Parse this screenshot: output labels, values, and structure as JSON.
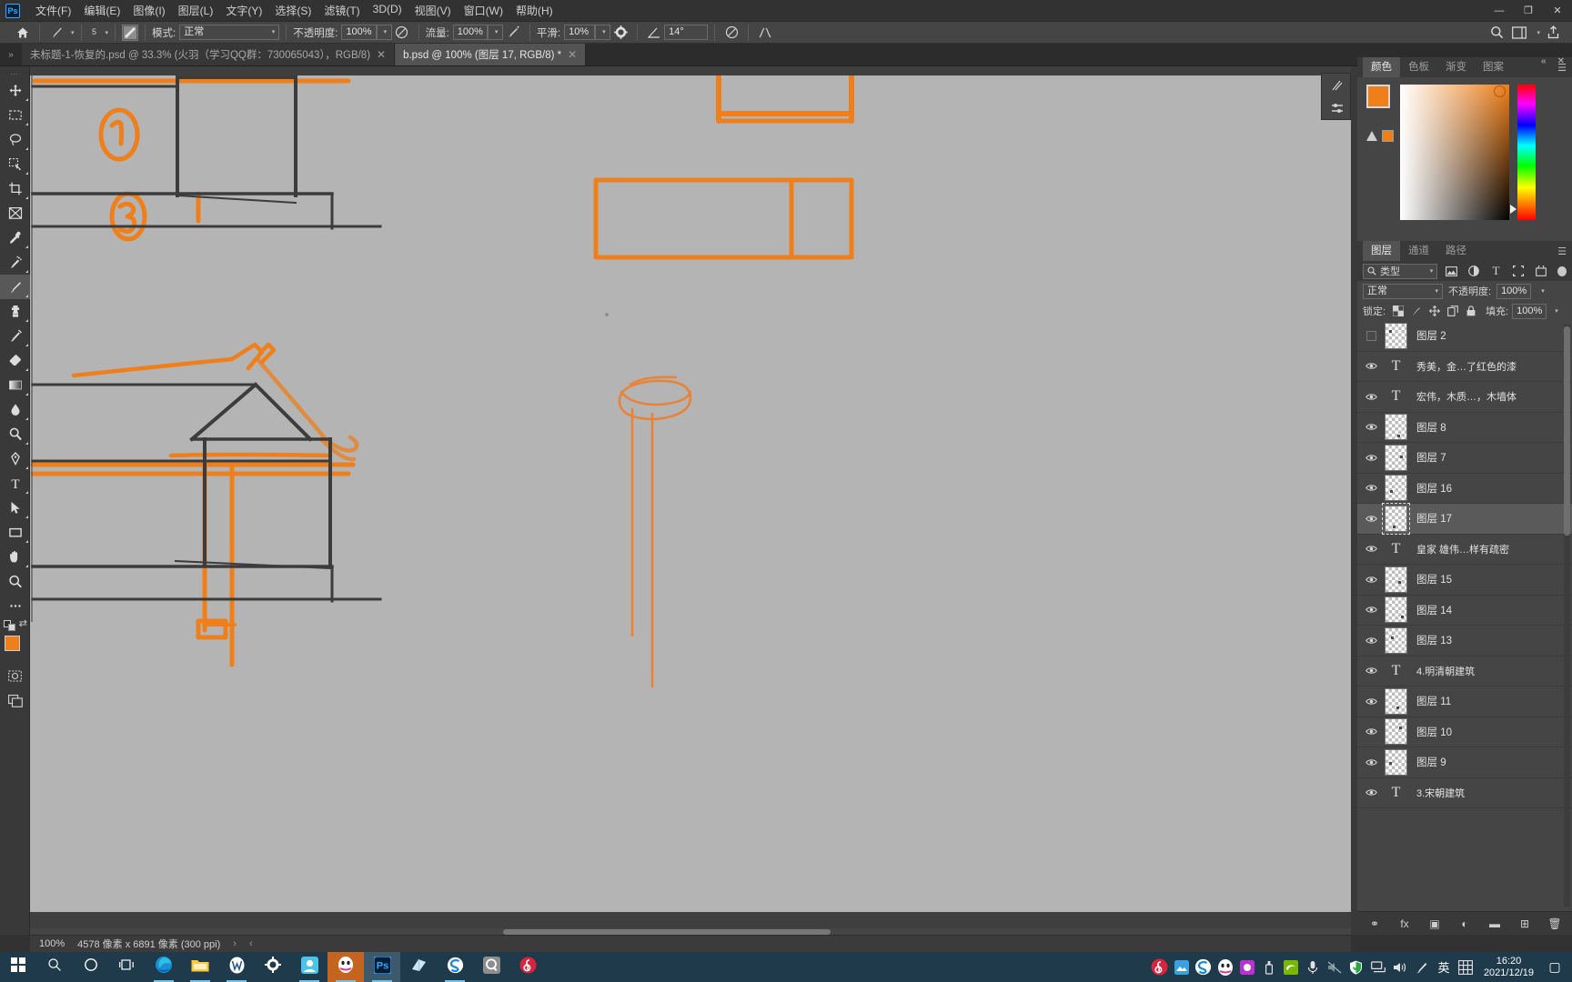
{
  "app": {
    "name": "Photoshop",
    "logo_text": "Ps"
  },
  "menubar": {
    "items": [
      {
        "label": "文件(F)",
        "name": "menu-file"
      },
      {
        "label": "编辑(E)",
        "name": "menu-edit"
      },
      {
        "label": "图像(I)",
        "name": "menu-image"
      },
      {
        "label": "图层(L)",
        "name": "menu-layer"
      },
      {
        "label": "文字(Y)",
        "name": "menu-type"
      },
      {
        "label": "选择(S)",
        "name": "menu-select"
      },
      {
        "label": "滤镜(T)",
        "name": "menu-filter"
      },
      {
        "label": "3D(D)",
        "name": "menu-3d"
      },
      {
        "label": "视图(V)",
        "name": "menu-view"
      },
      {
        "label": "窗口(W)",
        "name": "menu-window"
      },
      {
        "label": "帮助(H)",
        "name": "menu-help"
      }
    ],
    "window_controls": {
      "minimize": "—",
      "maximize": "❐",
      "close": "✕"
    }
  },
  "options_bar": {
    "home_icon": "home-icon",
    "brush_preset_icon": "brush-icon",
    "brush_size_label": "5",
    "toggle_panel_icon": "brush-panel-icon",
    "mode_label": "模式:",
    "mode_value": "正常",
    "opacity_label": "不透明度:",
    "opacity_value": "100%",
    "pressure_opacity_icon": "pressure-opacity-icon",
    "flow_label": "流量:",
    "flow_value": "100%",
    "airbrush_icon": "airbrush-icon",
    "smoothing_label": "平滑:",
    "smoothing_value": "10%",
    "gear_icon": "gear-icon",
    "angle_icon": "angle-icon",
    "angle_value": "14°",
    "pressure_size_icon": "pressure-size-icon",
    "symmetry_icon": "symmetry-icon",
    "search_icon": "search-icon",
    "workspace_icon": "workspace-icon",
    "share_icon": "share-icon"
  },
  "tabs": {
    "overflow_icon": "chevron-double-right-icon",
    "items": [
      {
        "label": "未标题-1-恢复的.psd @ 33.3% (火羽（学习QQ群：730065043），RGB/8)",
        "active": false,
        "close": "✕"
      },
      {
        "label": "b.psd @ 100% (图层 17, RGB/8) *",
        "active": true,
        "close": "✕"
      }
    ]
  },
  "toolbar": {
    "tools": [
      {
        "name": "move-tool",
        "icon": "move-icon",
        "has_submenu": true,
        "active": false
      },
      {
        "name": "marquee-tool",
        "icon": "rect-marquee-icon",
        "has_submenu": true,
        "active": false
      },
      {
        "name": "lasso-tool",
        "icon": "lasso-icon",
        "has_submenu": true,
        "active": false
      },
      {
        "name": "quick-select-tool",
        "icon": "quick-selection-icon",
        "has_submenu": true,
        "active": false
      },
      {
        "name": "crop-tool",
        "icon": "crop-icon",
        "has_submenu": true,
        "active": false
      },
      {
        "name": "frame-tool",
        "icon": "frame-icon",
        "has_submenu": false,
        "active": false
      },
      {
        "name": "eyedropper-tool",
        "icon": "eyedropper-icon",
        "has_submenu": true,
        "active": false
      },
      {
        "name": "healing-brush-tool",
        "icon": "spot-healing-icon",
        "has_submenu": true,
        "active": false
      },
      {
        "name": "brush-tool",
        "icon": "brush-icon",
        "has_submenu": true,
        "active": true
      },
      {
        "name": "clone-stamp-tool",
        "icon": "clone-stamp-icon",
        "has_submenu": true,
        "active": false
      },
      {
        "name": "history-brush-tool",
        "icon": "history-brush-icon",
        "has_submenu": true,
        "active": false
      },
      {
        "name": "eraser-tool",
        "icon": "eraser-icon",
        "has_submenu": true,
        "active": false
      },
      {
        "name": "gradient-tool",
        "icon": "gradient-icon",
        "has_submenu": true,
        "active": false
      },
      {
        "name": "blur-tool",
        "icon": "blur-drop-icon",
        "has_submenu": true,
        "active": false
      },
      {
        "name": "dodge-tool",
        "icon": "dodge-icon",
        "has_submenu": true,
        "active": false
      },
      {
        "name": "pen-tool",
        "icon": "pen-icon",
        "has_submenu": true,
        "active": false
      },
      {
        "name": "type-tool",
        "icon": "type-icon",
        "has_submenu": true,
        "active": false
      },
      {
        "name": "path-selection-tool",
        "icon": "path-select-arrow-icon",
        "has_submenu": true,
        "active": false
      },
      {
        "name": "shape-tool",
        "icon": "rectangle-shape-icon",
        "has_submenu": true,
        "active": false
      },
      {
        "name": "hand-tool",
        "icon": "hand-icon",
        "has_submenu": true,
        "active": false
      },
      {
        "name": "zoom-tool",
        "icon": "zoom-magnifier-icon",
        "has_submenu": false,
        "active": false
      },
      {
        "name": "edit-toolbar",
        "icon": "ellipsis-icon",
        "has_submenu": false,
        "active": false
      }
    ],
    "foreground_color": "#ef7f1a",
    "background_color": "#b9b9b9",
    "quickmask_icon": "quick-mask-icon",
    "screenmode_icon": "screen-mode-icon"
  },
  "canvas": {
    "background_color": "#b4b4b4",
    "ink_orange": "#ef7f1a",
    "ink_dark": "#3c3c3c",
    "annotations": [
      "①",
      "③"
    ]
  },
  "statusbar": {
    "zoom": "100%",
    "dimensions": "4578 像素 x 6891 像素 (300 ppi)",
    "arrow_right": "›",
    "arrow_left": "‹"
  },
  "color_panel": {
    "tabs": [
      {
        "label": "颜色",
        "active": true,
        "name": "tab-color"
      },
      {
        "label": "色板",
        "active": false,
        "name": "tab-swatches"
      },
      {
        "label": "渐变",
        "active": false,
        "name": "tab-gradients"
      },
      {
        "label": "图案",
        "active": false,
        "name": "tab-patterns"
      }
    ],
    "menu_icon": "panel-menu-icon",
    "collapse_icon": "collapse-icon",
    "close_icon": "close-icon",
    "foreground": "#ef7f1a",
    "background": "#c2c2c2",
    "out_of_gamut_warning": "out-of-gamut-icon",
    "warning_swatch": "#ef7f1a"
  },
  "layers_panel": {
    "tabs": [
      {
        "label": "图层",
        "active": true,
        "name": "tab-layers"
      },
      {
        "label": "通道",
        "active": false,
        "name": "tab-channels"
      },
      {
        "label": "路径",
        "active": false,
        "name": "tab-paths"
      }
    ],
    "menu_icon": "panel-menu-icon",
    "filter_label": "类型",
    "filter_icons": [
      "image-filter-icon",
      "adjustment-filter-icon",
      "type-filter-icon",
      "shape-filter-icon",
      "smart-object-filter-icon"
    ],
    "filter_toggle": "filter-toggle-icon",
    "blend_mode": "正常",
    "opacity_label": "不透明度:",
    "opacity_value": "100%",
    "lock_label": "锁定:",
    "lock_icons": [
      "lock-transparent-icon",
      "lock-image-icon",
      "lock-position-icon",
      "lock-artboard-icon",
      "lock-all-icon"
    ],
    "fill_label": "填充:",
    "fill_value": "100%",
    "layers": [
      {
        "name": "图层 2",
        "type": "raster",
        "visible": false,
        "selected": false
      },
      {
        "name": "秀美，金…了红色的漆",
        "type": "text",
        "visible": true,
        "selected": false
      },
      {
        "name": "宏伟，木质…，木墙体",
        "type": "text",
        "visible": true,
        "selected": false
      },
      {
        "name": "图层 8",
        "type": "raster",
        "visible": true,
        "selected": false
      },
      {
        "name": "图层 7",
        "type": "raster",
        "visible": true,
        "selected": false
      },
      {
        "name": "图层 16",
        "type": "raster",
        "visible": true,
        "selected": false
      },
      {
        "name": "图层 17",
        "type": "raster",
        "visible": true,
        "selected": true
      },
      {
        "name": "皇家 雄伟…样有疏密",
        "type": "text",
        "visible": true,
        "selected": false
      },
      {
        "name": "图层 15",
        "type": "raster",
        "visible": true,
        "selected": false
      },
      {
        "name": "图层 14",
        "type": "raster",
        "visible": true,
        "selected": false
      },
      {
        "name": "图层 13",
        "type": "raster",
        "visible": true,
        "selected": false
      },
      {
        "name": "4.明清朝建筑",
        "type": "text",
        "visible": true,
        "selected": false
      },
      {
        "name": "图层 11",
        "type": "raster",
        "visible": true,
        "selected": false
      },
      {
        "name": "图层 10",
        "type": "raster",
        "visible": true,
        "selected": false
      },
      {
        "name": "图层 9",
        "type": "raster",
        "visible": true,
        "selected": false
      },
      {
        "name": "3.宋朝建筑",
        "type": "text",
        "visible": true,
        "selected": false
      }
    ],
    "footer_icons": [
      {
        "name": "link-layers-button",
        "glyph": "⚭"
      },
      {
        "name": "layer-style-button",
        "glyph": "fx"
      },
      {
        "name": "layer-mask-button",
        "glyph": "▣"
      },
      {
        "name": "adjustment-layer-button",
        "glyph": "◐"
      },
      {
        "name": "new-group-button",
        "glyph": "▬"
      },
      {
        "name": "new-layer-button",
        "glyph": "⊞"
      },
      {
        "name": "delete-layer-button",
        "glyph": "🗑"
      }
    ]
  },
  "taskbar": {
    "items": [
      {
        "name": "start-button",
        "icon": "windows-icon",
        "state": "normal"
      },
      {
        "name": "search-button",
        "icon": "search-icon",
        "state": "normal"
      },
      {
        "name": "cortana-button",
        "icon": "cortana-circle-icon",
        "state": "normal"
      },
      {
        "name": "task-view-button",
        "icon": "task-view-icon",
        "state": "normal"
      },
      {
        "name": "edge-taskbar-item",
        "icon": "edge-icon",
        "state": "running"
      },
      {
        "name": "explorer-taskbar-item",
        "icon": "folder-icon",
        "state": "running"
      },
      {
        "name": "wps-taskbar-item",
        "icon": "wps-icon",
        "state": "running"
      },
      {
        "name": "settings-taskbar-item",
        "icon": "gear-icon",
        "state": "normal"
      },
      {
        "name": "app-taskbar-item",
        "icon": "blue-app-icon",
        "state": "running"
      },
      {
        "name": "qq-taskbar-item",
        "icon": "qq-icon",
        "state": "active-orange"
      },
      {
        "name": "photoshop-taskbar-item",
        "icon": "ps-icon",
        "state": "active-blue"
      },
      {
        "name": "store-taskbar-item",
        "icon": "store-icon",
        "state": "normal"
      },
      {
        "name": "sogou-taskbar-item",
        "icon": "sogou-icon",
        "state": "running"
      },
      {
        "name": "quark-taskbar-item",
        "icon": "quark-icon",
        "state": "normal"
      },
      {
        "name": "netease-music-taskbar-item",
        "icon": "netease-icon",
        "state": "normal"
      }
    ],
    "tray": [
      {
        "name": "tray-netease-icon",
        "icon": "netease-icon"
      },
      {
        "name": "tray-photo-icon",
        "icon": "photo-icon"
      },
      {
        "name": "tray-sogou-icon",
        "icon": "sogou-icon"
      },
      {
        "name": "tray-qq-icon",
        "icon": "qq-icon"
      },
      {
        "name": "tray-app-icon",
        "icon": "purple-app-icon"
      },
      {
        "name": "tray-usb-icon",
        "icon": "usb-icon"
      },
      {
        "name": "tray-nvidia-icon",
        "icon": "nvidia-icon"
      },
      {
        "name": "tray-microphone-icon",
        "icon": "microphone-icon"
      },
      {
        "name": "tray-muted-icon",
        "icon": "muted-icon"
      },
      {
        "name": "tray-defender-icon",
        "icon": "shield-icon"
      },
      {
        "name": "tray-network-icon",
        "icon": "network-icon"
      },
      {
        "name": "tray-volume-icon",
        "icon": "volume-icon"
      },
      {
        "name": "tray-pen-icon",
        "icon": "pen-icon"
      },
      {
        "name": "tray-ime-icon",
        "icon": "ime-chinese-icon",
        "label": "英"
      },
      {
        "name": "tray-keyboard-icon",
        "icon": "keyboard-icon"
      }
    ],
    "clock_time": "16:20",
    "clock_date": "2021/12/19",
    "notification_icon": "notification-icon"
  }
}
